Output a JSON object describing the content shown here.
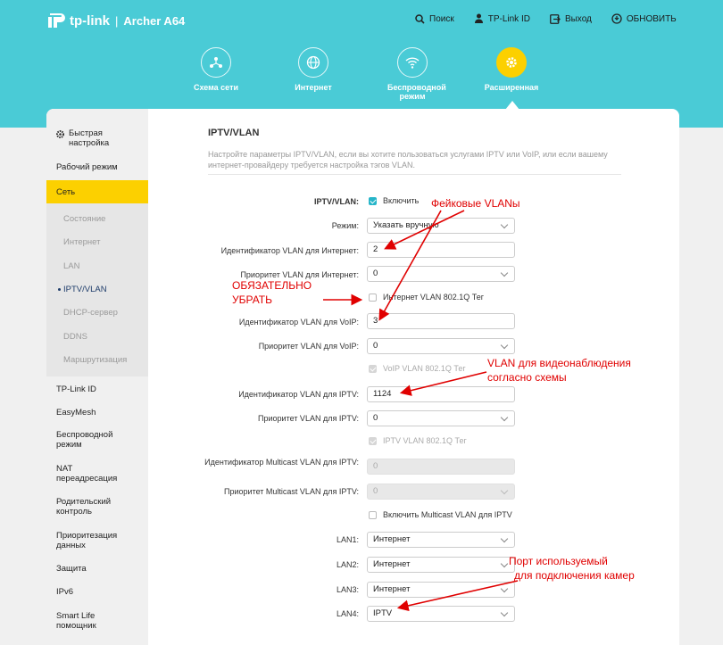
{
  "header": {
    "brand": "tp-link",
    "separator": "|",
    "model": "Archer A64",
    "nav": [
      {
        "icon": "search-icon",
        "label": "Поиск"
      },
      {
        "icon": "user-icon",
        "label": "TP-Link ID"
      },
      {
        "icon": "logout-icon",
        "label": "Выход"
      },
      {
        "icon": "refresh-icon",
        "label": "ОБНОВИТЬ"
      }
    ],
    "tabs": [
      {
        "icon": "network-map-icon",
        "label": "Схема сети"
      },
      {
        "icon": "globe-icon",
        "label": "Интернет"
      },
      {
        "icon": "wifi-icon",
        "label": "Беспроводной режим"
      },
      {
        "icon": "gear-icon",
        "label": "Расширенная",
        "active": true
      }
    ],
    "accent_color": "#4acbd6",
    "active_color": "#fcd000"
  },
  "sidebar": {
    "items": [
      {
        "label": "Быстрая настройка"
      },
      {
        "label": "Рабочий режим"
      },
      {
        "label": "Сеть"
      },
      {
        "label": "Состояние"
      },
      {
        "label": "Интернет"
      },
      {
        "label": "LAN"
      },
      {
        "label": "IPTV/VLAN"
      },
      {
        "label": "DHCP-сервер"
      },
      {
        "label": "DDNS"
      },
      {
        "label": "Маршрутизация"
      },
      {
        "label": "TP-Link ID"
      },
      {
        "label": "EasyMesh"
      },
      {
        "label": "Беспроводной режим"
      },
      {
        "label": "NAT переадресация"
      },
      {
        "label": "Родительский контроль"
      },
      {
        "label": "Приоритезация данных"
      },
      {
        "label": "Защита"
      },
      {
        "label": "IPv6"
      },
      {
        "label": "Smart Life помощник"
      }
    ]
  },
  "main": {
    "title": "IPTV/VLAN",
    "description": "Настройте параметры IPTV/VLAN, если вы хотите пользоваться услугами IPTV или VoIP, или если вашему интернет-провайдеру требуется настройка тэгов VLAN.",
    "form": {
      "iptv_label": "IPTV/VLAN:",
      "iptv_enable": "Включить",
      "mode_label": "Режим:",
      "mode_value": "Указать вручную",
      "inet_vid_label": "Идентификатор VLAN для Интернет:",
      "inet_vid_value": "2",
      "inet_prio_label": "Приоритет VLAN для Интернет:",
      "inet_prio_value": "0",
      "inet_tag_label": "Интернет VLAN 802.1Q Тег",
      "voip_vid_label": "Идентификатор VLAN для VoIP:",
      "voip_vid_value": "3",
      "voip_prio_label": "Приоритет VLAN для VoIP:",
      "voip_prio_value": "0",
      "voip_tag_label": "VoIP VLAN 802.1Q Тег",
      "iptv_vid_label": "Идентификатор VLAN для IPTV:",
      "iptv_vid_value": "1124",
      "iptv_prio_label": "Приоритет VLAN для IPTV:",
      "iptv_prio_value": "0",
      "iptv_tag_label": "IPTV VLAN 802.1Q Тег",
      "mc_vid_label": "Идентификатор Multicast VLAN для IPTV:",
      "mc_vid_value": "0",
      "mc_prio_label": "Приоритет Multicast VLAN для IPTV:",
      "mc_prio_value": "0",
      "mc_enable_label": "Включить Multicast VLAN для IPTV",
      "lan1_label": "LAN1:",
      "lan1_value": "Интернет",
      "lan2_label": "LAN2:",
      "lan2_value": "Интернет",
      "lan3_label": "LAN3:",
      "lan3_value": "Интернет",
      "lan4_label": "LAN4:",
      "lan4_value": "IPTV"
    }
  },
  "annotations": {
    "fake_vlans": "Фейковые VLANы",
    "must_remove_1": "ОБЯЗАТЕЛЬНО",
    "must_remove_2": "УБРАТЬ",
    "cctv_1": "VLAN для видеонаблюдения",
    "cctv_2": "согласно схемы",
    "port_1": "Порт используемый",
    "port_2": "для подключения камер",
    "color": "#e00000"
  }
}
